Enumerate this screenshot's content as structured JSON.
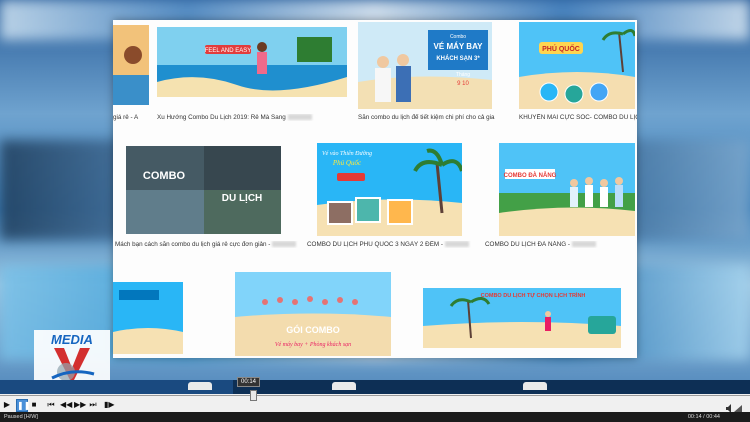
{
  "window": {
    "title": "Video player"
  },
  "video": {
    "captions": [
      {
        "text": "giá rẻ - A"
      },
      {
        "text": "Xu Hướng Combo Du Lịch 2019: Rẻ Mà Sang"
      },
      {
        "text": "Săn combo du lịch để tiết kiệm chi phí cho cả gia"
      },
      {
        "text": "KHUYẾN MÃI CỰC SỐC- COMBO DU LỊC"
      },
      {
        "text": "Mách bạn cách săn combo du lịch giá rẻ cực đơn giản -"
      },
      {
        "text": "COMBO DU LỊCH PHÚ QUỐC 3 NGÀY 2 ĐÊM -"
      },
      {
        "text": "COMBO DU LỊCH ĐÀ NẴNG -"
      }
    ],
    "thumb_texts": {
      "feel_and_easy": "FEEL AND EASY",
      "ve_may_bay": "VÉ MÁY BAY",
      "khach_san": "KHÁCH SẠN 3*",
      "combo_small": "Combo",
      "thang": "Tháng",
      "thang_num": "9 10",
      "phu_quoc": "PHÚ QUỐC",
      "combo": "COMBO",
      "du_lich": "DU LỊCH",
      "ve_thien_duong": "Vé vào Thiên Đường",
      "phu_quoc_small": "Phú Quốc",
      "combo_da_nang": "COMBO ĐÀ NẴNG",
      "goi_combo": "GÓI COMBO",
      "ve_may_bay_ks": "Vé máy bay + Phòng khách sạn",
      "combo_banner": "COMBO DU LỊCH TỰ CHỌN LỊCH TRÌNH"
    },
    "logo": {
      "text": "MEDIA",
      "letter": "V"
    }
  },
  "player": {
    "time_tooltip": "00:14",
    "progress": 0.31,
    "buttons": {
      "play": "▶",
      "pause": "❚❚",
      "stop": "■",
      "prev": "⏮",
      "rewind": "◀◀",
      "forward": "▶▶",
      "next": "⏭",
      "frame": "▮▶"
    },
    "status_left": "Paused [H/W]",
    "status_right": "00:14 / 00:44",
    "colors": {
      "accent": "#4a90d9",
      "progress": "#0d2f55"
    }
  }
}
